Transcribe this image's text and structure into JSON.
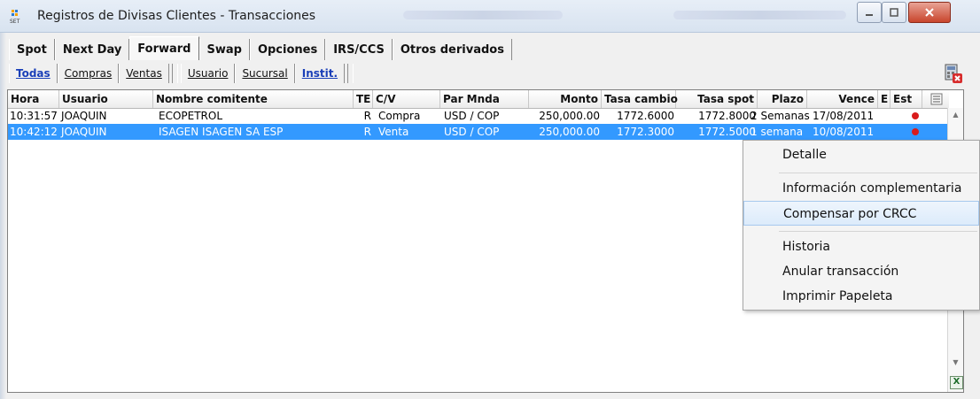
{
  "window": {
    "title": "Registros de Divisas Clientes - Transacciones"
  },
  "tabs": [
    {
      "label": "Spot"
    },
    {
      "label": "Next Day"
    },
    {
      "label": "Forward"
    },
    {
      "label": "Swap"
    },
    {
      "label": "Opciones"
    },
    {
      "label": "IRS/CCS"
    },
    {
      "label": "Otros derivados"
    }
  ],
  "toolbar": {
    "buttons": [
      {
        "label": "Todas"
      },
      {
        "label": "Compras"
      },
      {
        "label": "Ventas"
      },
      {
        "label": "Usuario"
      },
      {
        "label": "Sucursal"
      },
      {
        "label": "Instit."
      }
    ]
  },
  "table": {
    "columns": [
      {
        "label": "Hora"
      },
      {
        "label": "Usuario"
      },
      {
        "label": "Nombre comitente"
      },
      {
        "label": "TE"
      },
      {
        "label": "C/V"
      },
      {
        "label": "Par Mnda"
      },
      {
        "label": "Monto"
      },
      {
        "label": "Tasa cambio"
      },
      {
        "label": "Tasa spot"
      },
      {
        "label": "Plazo"
      },
      {
        "label": "Vence"
      },
      {
        "label": "E"
      },
      {
        "label": "Est"
      }
    ],
    "rows": [
      [
        "10:31:57",
        "JOAQUIN",
        "ECOPETROL",
        "R",
        "Compra",
        "USD / COP",
        "250,000.00",
        "1772.6000",
        "1772.8000",
        "2 Semanas",
        "17/08/2011",
        "",
        ""
      ],
      [
        "10:42:12",
        "JOAQUIN",
        "ISAGEN ISAGEN SA ESP",
        "R",
        "Venta",
        "USD / COP",
        "250,000.00",
        "1772.3000",
        "1772.5000",
        "1 semana",
        "10/08/2011",
        "",
        ""
      ]
    ]
  },
  "context_menu": {
    "items": [
      {
        "label": "Detalle"
      },
      {
        "label": "Información complementaria"
      },
      {
        "label": "Compensar por CRCC"
      },
      {
        "label": "Historia"
      },
      {
        "label": "Anular transacción"
      },
      {
        "label": "Imprimir Papeleta"
      }
    ]
  },
  "colors": {
    "selection": "#3399ff",
    "status_dot": "#d91c1c",
    "link_blue": "#1a3fb8"
  }
}
